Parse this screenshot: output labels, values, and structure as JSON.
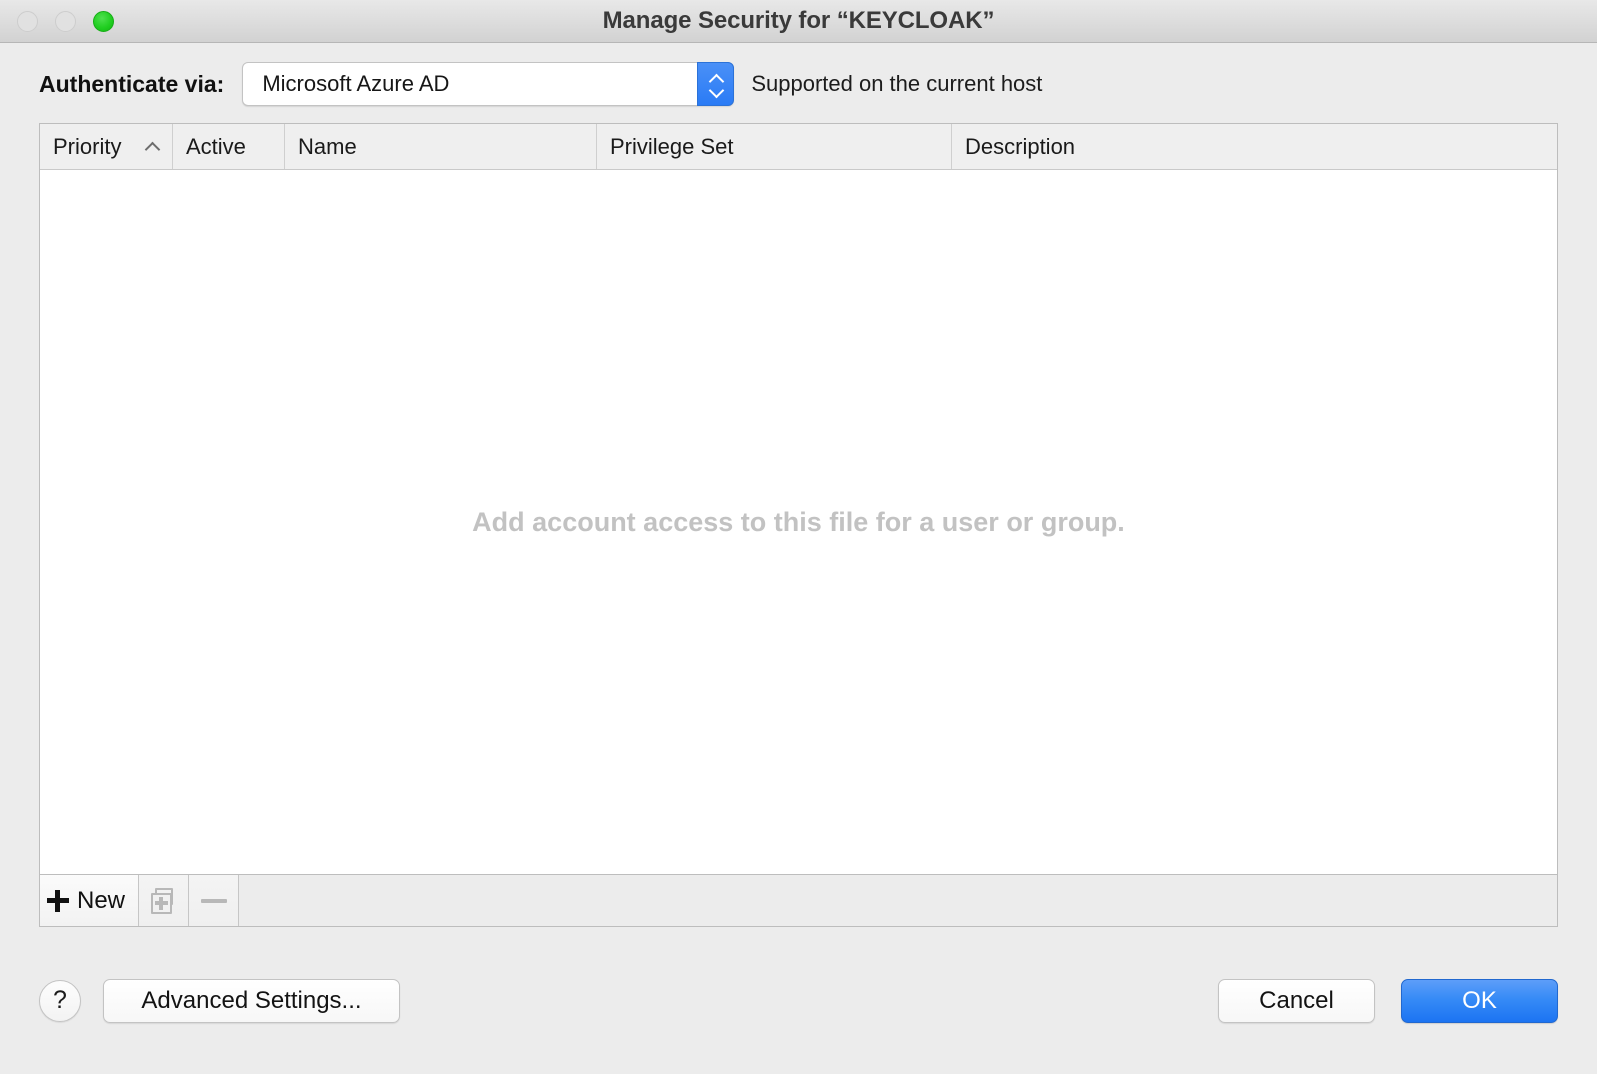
{
  "window": {
    "title": "Manage Security for “KEYCLOAK”",
    "traffic_lights": {
      "close_label": "close",
      "minimize_label": "minimize",
      "zoom_label": "zoom"
    }
  },
  "auth": {
    "label": "Authenticate via:",
    "selected_value": "Microsoft Azure AD",
    "status_text": "Supported on the current host"
  },
  "table": {
    "columns": [
      {
        "label": "Priority",
        "sorted": "ascending"
      },
      {
        "label": "Active",
        "sorted": ""
      },
      {
        "label": "Name",
        "sorted": ""
      },
      {
        "label": "Privilege Set",
        "sorted": ""
      },
      {
        "label": "Description",
        "sorted": ""
      }
    ],
    "rows": [],
    "empty_message": "Add account access to this file for a user or group."
  },
  "table_toolbar": {
    "new_label": "New",
    "new_icon": "plus-icon",
    "duplicate_icon": "duplicate-icon",
    "remove_icon": "minus-icon"
  },
  "footer": {
    "help_label": "?",
    "advanced_settings_label": "Advanced Settings...",
    "cancel_label": "Cancel",
    "ok_label": "OK"
  },
  "colors": {
    "accent_blue": "#2a7bf5",
    "default_button_blue": "#368bf6",
    "zoom_green": "#22cf22",
    "window_background": "#ececec",
    "table_header": "#efefef",
    "empty_text": "#c2c2c2"
  }
}
